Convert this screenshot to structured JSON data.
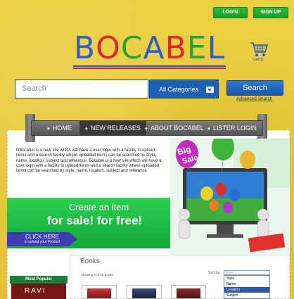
{
  "header": {
    "login_label": "LOGIN",
    "signup_label": "SIGN UP",
    "logo_letters": [
      {
        "char": "B",
        "color": "#2d5fd0"
      },
      {
        "char": "O",
        "color": "#e0262a"
      },
      {
        "char": "C",
        "color": "#2aa336"
      },
      {
        "char": "A",
        "color": "#2d5fd0"
      },
      {
        "char": "B",
        "color": "#e0262a"
      },
      {
        "char": "E",
        "color": "#2aa336"
      },
      {
        "char": "L",
        "color": "#2d5fd0"
      }
    ],
    "cart_label": "Cart(2)"
  },
  "search": {
    "placeholder": "Search",
    "category_selected": "All Categories",
    "button_label": "Search",
    "advanced_label": "Advanced Search"
  },
  "nav": {
    "items": [
      {
        "label": "HOME"
      },
      {
        "label": "NEW RELEASES"
      },
      {
        "label": "ABOUT BOCABEL"
      },
      {
        "label": "LISTER LOGIN"
      }
    ]
  },
  "intro": {
    "text": "DBocabel is a new site which will have a user login with a facility to upload items and a search facility where uploaded items can be searched by style, name, location, subject and reference. Bocabel is a new site which will have a user login with a facility to upload items and a search facility where uploaded items can be searched by style, name, location, subject and reference."
  },
  "hero": {
    "balloon_text_1": "Big",
    "balloon_text_2": "Sale"
  },
  "banner": {
    "line1": "Create an item",
    "line2": "for sale! for free!",
    "click_label": "CLICK HERE",
    "click_sub": "to upload your Product"
  },
  "books": {
    "title": "Books",
    "showing": "Showing 9 of 30 Books",
    "sort_by_label": "Sort by:",
    "sort_placeholder": "Style",
    "sort_options": [
      "Style",
      "Name",
      "Location",
      "Subject"
    ],
    "sort_highlighted": "Location"
  },
  "sidebar": {
    "most_popular": "Most Popular",
    "popular_book_text": "RAVI"
  },
  "colors": {
    "accent_green": "#159b27",
    "accent_blue": "#1f5fb5",
    "background_yellow": "#e7c93a"
  }
}
